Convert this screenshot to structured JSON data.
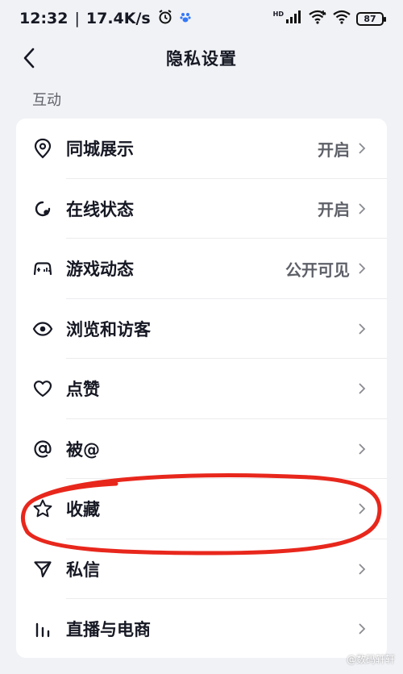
{
  "status_bar": {
    "time": "12:32",
    "network_speed": "17.4K/s",
    "hd_label": "HD",
    "battery": "87",
    "icons": [
      "alarm-icon",
      "paw-icon",
      "signal-icon",
      "wifi-icon",
      "battery-icon"
    ]
  },
  "navbar": {
    "title": "隐私设置"
  },
  "section": {
    "label": "互动"
  },
  "items": [
    {
      "label": "同城展示",
      "value": "开启",
      "icon": "location-pin-icon"
    },
    {
      "label": "在线状态",
      "value": "开启",
      "icon": "online-status-icon"
    },
    {
      "label": "游戏动态",
      "value": "公开可见",
      "icon": "game-controller-icon"
    },
    {
      "label": "浏览和访客",
      "value": "",
      "icon": "eye-icon"
    },
    {
      "label": "点赞",
      "value": "",
      "icon": "heart-icon"
    },
    {
      "label": "被@",
      "value": "",
      "icon": "at-icon"
    },
    {
      "label": "收藏",
      "value": "",
      "icon": "star-icon"
    },
    {
      "label": "私信",
      "value": "",
      "icon": "send-icon"
    },
    {
      "label": "直播与电商",
      "value": "",
      "icon": "bar-chart-icon"
    }
  ],
  "annotation_color": "#e8271c",
  "watermark": "@数码轩轩"
}
